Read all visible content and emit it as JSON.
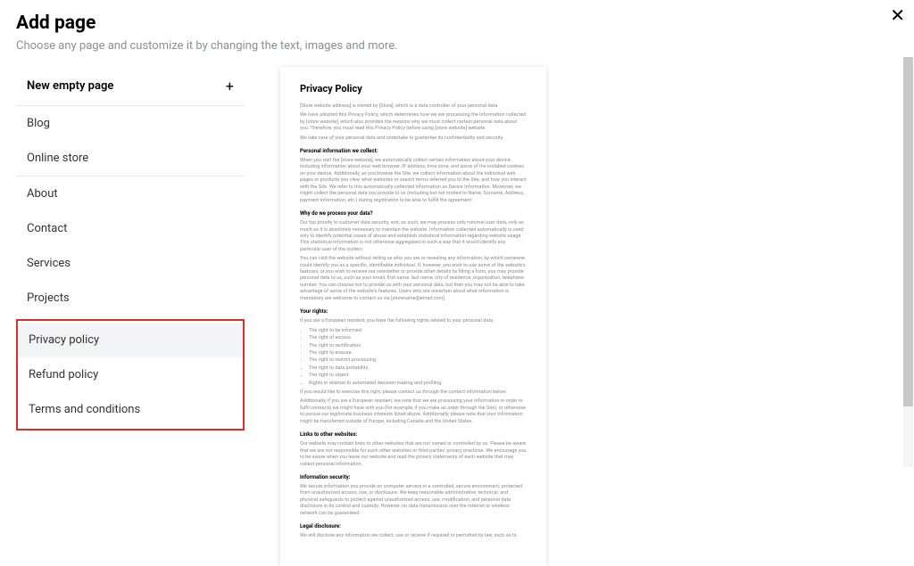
{
  "header": {
    "title": "Add page",
    "subtitle": "Choose any page and customize it by changing the text, images and more."
  },
  "close": "✕",
  "new_page_label": "New empty page",
  "plus": "+",
  "sidebar": {
    "group1": [
      {
        "label": "Blog"
      },
      {
        "label": "Online store"
      }
    ],
    "group2": [
      {
        "label": "About"
      },
      {
        "label": "Contact"
      },
      {
        "label": "Services"
      },
      {
        "label": "Projects"
      }
    ],
    "group3": [
      {
        "label": "Privacy policy",
        "selected": true
      },
      {
        "label": "Refund policy"
      },
      {
        "label": "Terms and conditions"
      }
    ]
  },
  "preview": {
    "title": "Privacy Policy",
    "intro1": "[Store website address] is owned by [Store], which is a data controller of your personal data.",
    "intro2": "We have adopted this Privacy Policy, which determines how we are processing the information collected by [store website], which also provides the reasons why we must collect certain personal data about you. Therefore, you must read this Privacy Policy before using [store website] website.",
    "intro3": "We take care of your personal data and undertake to guarantee its confidentiality and security.",
    "sec1": {
      "head": "Personal information we collect:",
      "p1": "When you visit the [store website], we automatically collect certain information about your device, including information about your web browser, IP address, time zone, and some of the installed cookies on your device. Additionally, as you browse the Site, we collect information about the individual web pages or products you view, what websites or search terms referred you to the Site, and how you interact with the Site. We refer to this automatically-collected information as Device Information. Moreover, we might collect the personal data you provide to us (including but not limited to Name, Surname, Address, payment information, etc.) during registration to be able to fulfill the agreement."
    },
    "sec2": {
      "head": "Why do we process your data?",
      "p1": "Our top priority is customer data security, and, as such, we may process only minimal user data, only as much as it is absolutely necessary to maintain the website. Information collected automatically is used only to identify potential cases of abuse and establish statistical information regarding website usage. This statistical information is not otherwise aggregated in such a way that it would identify any particular user of the system.",
      "p2": "You can visit the website without telling us who you are or revealing any information, by which someone could identify you as a specific, identifiable individual. If, however, you wish to use some of the website's features, or you wish to receive our newsletter or provide other details by filling a form, you may provide personal data to us, such as your email, first name, last name, city of residence, organization, telephone number. You can choose not to provide us with your personal data, but then you may not be able to take advantage of some of the website's features. Users who are uncertain about what information is mandatory are welcome to contact us via [storename@email.com]."
    },
    "sec3": {
      "head": "Your rights:",
      "lead": "If you are a European resident, you have the following rights related to your personal data:",
      "items": [
        "The right to be informed.",
        "The right of access.",
        "The right to rectification.",
        "The right to erasure.",
        "The right to restrict processing.",
        "The right to data portability.",
        "The right to object.",
        "Rights in relation to automated decision-making and profiling."
      ],
      "p2": "If you would like to exercise this right, please contact us through the contact information below.",
      "p3": "Additionally, if you are a European resident, we note that we are processing your information in order to fulfil contracts we might have with you (for example, if you make an order through the Site), or otherwise to pursue our legitimate business interests listed above. Additionally, please note that your information might be transferred outside of Europe, including Canada and the United States."
    },
    "sec4": {
      "head": "Links to other websites:",
      "p1": "Our website may contain links to other websites that are not owned or controlled by us. Please be aware that we are not responsible for such other websites or third parties' privacy practices. We encourage you to be aware when you leave our website and read the privacy statements of each website that may collect personal information."
    },
    "sec5": {
      "head": "Information security:",
      "p1": "We secure information you provide on computer servers in a controlled, secure environment, protected from unauthorized access, use, or disclosure. We keep reasonable administrative, technical, and physical safeguards to protect against unauthorized access, use, modification, and personal data disclosure in its control and custody. However, no data transmission over the Internet or wireless network can be guaranteed."
    },
    "sec6": {
      "head": "Legal disclosure:",
      "p1": "We will disclose any information we collect, use or receive if required or permitted by law, such as to"
    }
  }
}
